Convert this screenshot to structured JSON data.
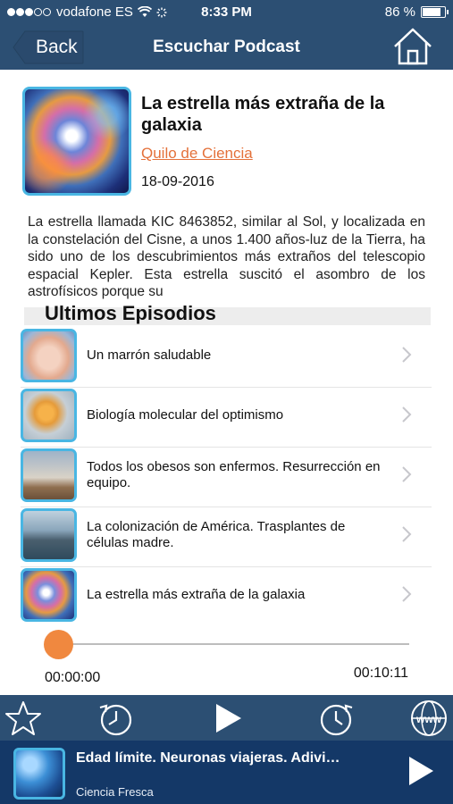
{
  "status_bar": {
    "carrier": "vodafone ES",
    "time": "8:33 PM",
    "battery": "86 %"
  },
  "nav": {
    "back_label": "Back",
    "title": "Escuchar Podcast",
    "home_icon": "home-icon"
  },
  "episode": {
    "title": "La estrella más extraña de la galaxia",
    "author": "Quilo de Ciencia",
    "date": "18-09-2016",
    "description": "La estrella llamada KIC 8463852, similar al Sol, y localizada en la constelación del Cisne, a unos 1.400 años-luz de la Tierra, ha sido uno de los descubrimientos más extraños del telescopio espacial Kepler. Esta estrella suscitó el asombro de los astrofísicos porque su"
  },
  "latest": {
    "heading": "Ultimos Episodios",
    "items": [
      {
        "label": "Un marrón saludable"
      },
      {
        "label": "Biología molecular del optimismo"
      },
      {
        "label": "Todos los obesos son enfermos. Resurrección en equipo."
      },
      {
        "label": "La colonización de América. Trasplantes de células madre."
      },
      {
        "label": "La estrella más extraña de la galaxia"
      }
    ]
  },
  "playback": {
    "position": "00:00:00",
    "duration": "00:10:11",
    "progress": 0.0
  },
  "toolbar": {
    "items": [
      "star-icon",
      "rewind-clock-icon",
      "play-icon",
      "forward-clock-icon",
      "www-globe-icon"
    ]
  },
  "mini_player": {
    "title": "Edad límite. Neuronas viajeras. Adivi…",
    "subtitle": "Ciencia Fresca"
  },
  "colors": {
    "nav_bg": "#2c4f73",
    "player_bg": "#143867",
    "accent": "#f0883f",
    "thumb_border": "#49b6e3",
    "link": "#e4713a"
  }
}
